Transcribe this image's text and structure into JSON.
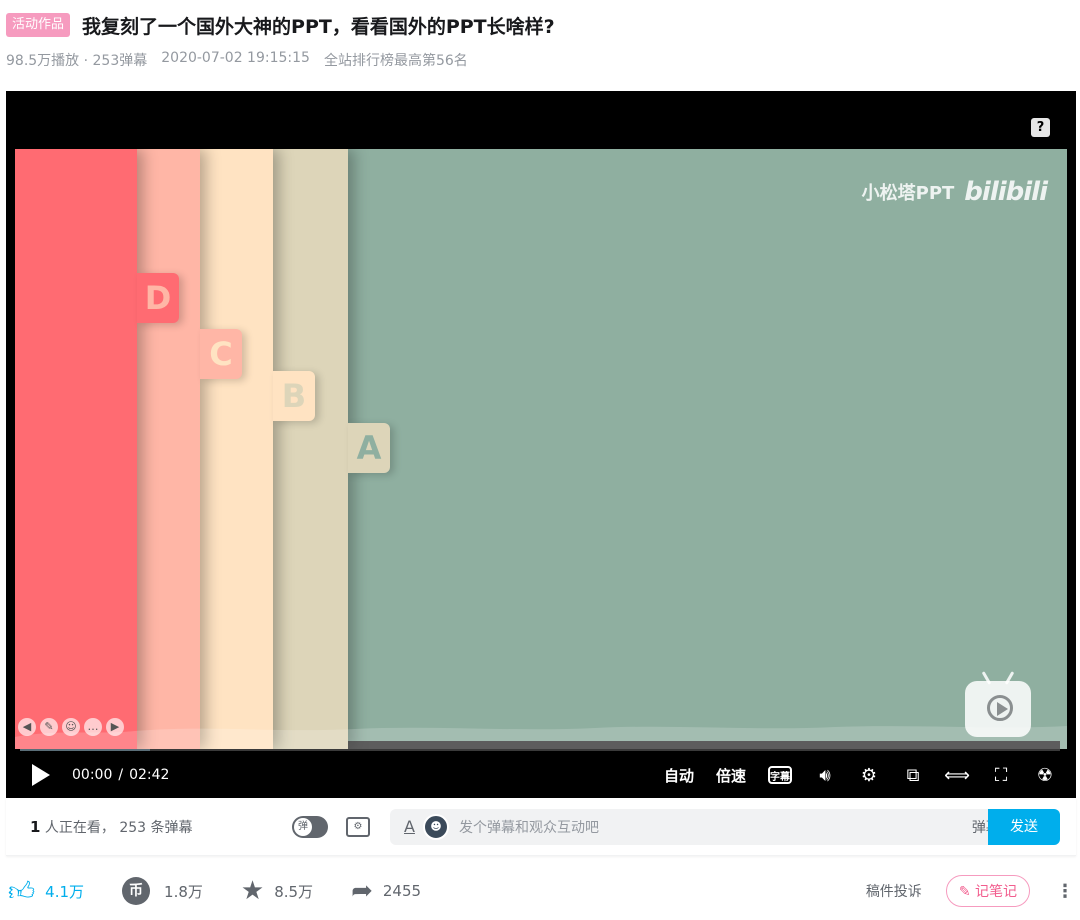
{
  "header": {
    "tag": "活动作品",
    "title": "我复刻了一个国外大神的PPT，看看国外的PPT长啥样?",
    "plays": "98.5万播放 · 253弹幕",
    "date": "2020-07-02 19:15:15",
    "rank": "全站排行榜最高第56名"
  },
  "player": {
    "help": "?",
    "watermark_text": "小松塔PPT",
    "watermark_logo": "bilibili",
    "slide_tabs": [
      "D",
      "C",
      "B",
      "A"
    ],
    "slide_colors": [
      "#ff6b72",
      "#ffb6a6",
      "#ffe3c2",
      "#ddd5b9",
      "#8fafa0"
    ],
    "current_time": "00:00",
    "total_time": "02:42",
    "progress": 0.125,
    "quality": "自动",
    "speed": "倍速",
    "subtitle_icon": "字幕",
    "icons": [
      "volume-icon",
      "settings-icon",
      "picture-in-picture-icon",
      "widescreen-icon",
      "web-fullscreen-icon",
      "fullscreen-icon"
    ]
  },
  "danmaku_bar": {
    "viewers_count": "1",
    "viewers_text": "人正在看，",
    "danmaku_count": "253",
    "danmaku_text": "条弹幕",
    "toggle_label": "弹",
    "font_label": "A",
    "placeholder": "发个弹幕和观众互动吧",
    "etiquette": "弹幕礼仪 >",
    "send": "发送"
  },
  "actions": {
    "like": "4.1万",
    "coin": "1.8万",
    "coin_icon": "币",
    "favorite": "8.5万",
    "share": "2455",
    "report": "稿件投诉",
    "note": "记笔记",
    "more": "⋮"
  },
  "colors": {
    "accent": "#00aeec",
    "pink": "#f25d8e"
  }
}
